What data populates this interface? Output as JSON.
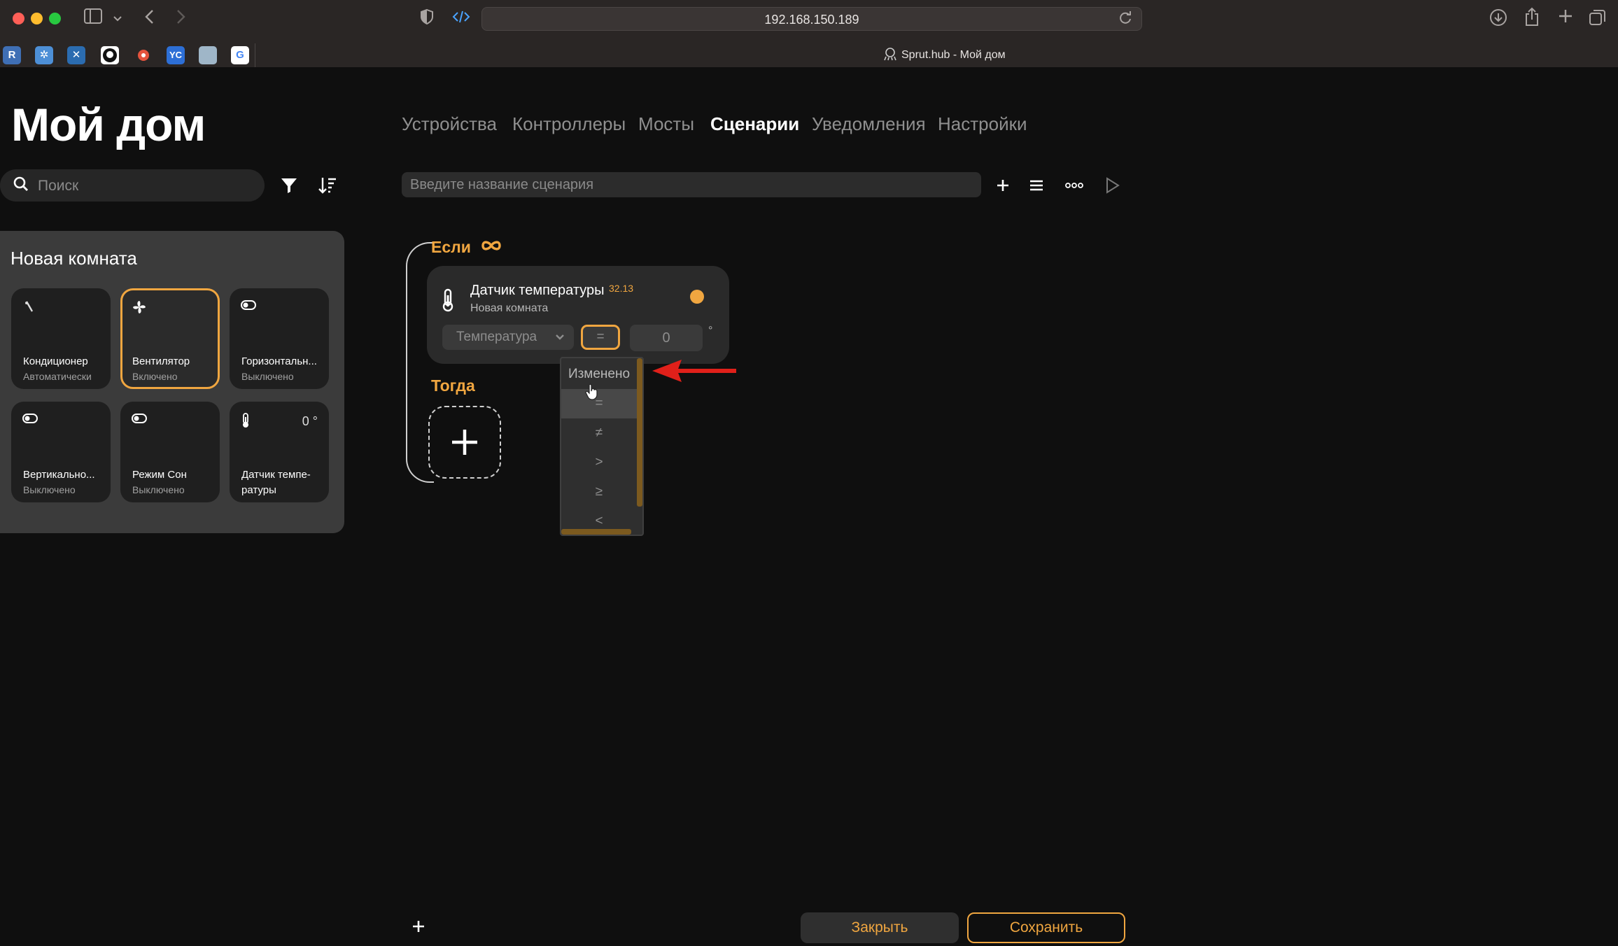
{
  "browser": {
    "url": "192.168.150.189",
    "tab_title": "Sprut.hub - Мой дом",
    "favicons": [
      "R",
      "✲",
      "✕",
      "",
      "",
      "YC",
      "",
      "G"
    ]
  },
  "app": {
    "page_title": "Мой дом",
    "search_placeholder": "Поиск",
    "room": {
      "title": "Новая комната",
      "tiles": [
        {
          "name": "Кондиционер",
          "status": "Автоматически",
          "icon": "ac-icon",
          "active": false
        },
        {
          "name": "Вентилятор",
          "status": "Включено",
          "icon": "fan-icon",
          "active": true
        },
        {
          "name": "Горизонтальн...",
          "status": "Выключено",
          "icon": "toggle-icon",
          "active": false
        },
        {
          "name": "Вертикально...",
          "status": "Выключено",
          "icon": "toggle-icon",
          "active": false
        },
        {
          "name": "Режим Сон",
          "status": "Выключено",
          "icon": "toggle-icon",
          "active": false
        },
        {
          "name": "Датчик темпе-ратуры",
          "status": "",
          "icon": "thermometer-icon",
          "value": "0 °",
          "active": false
        }
      ]
    },
    "nav_tabs": [
      {
        "label": "Устройства",
        "active": false
      },
      {
        "label": "Контроллеры",
        "active": false
      },
      {
        "label": "Мосты",
        "active": false
      },
      {
        "label": "Сценарии",
        "active": true
      },
      {
        "label": "Уведомления",
        "active": false
      },
      {
        "label": "Настройки",
        "active": false
      }
    ],
    "scenario": {
      "name_placeholder": "Введите название сценария",
      "if_label": "Если",
      "then_label": "Тогда",
      "condition": {
        "device_name": "Датчик температуры",
        "device_value": "32.13",
        "device_room": "Новая комната",
        "characteristic": "Температура",
        "operator": "=",
        "value": "0",
        "unit": "°"
      },
      "operator_options": [
        "Изменено",
        "=",
        "≠",
        ">",
        "≥",
        "<"
      ],
      "hovered_option": "="
    },
    "footer": {
      "close_label": "Закрыть",
      "save_label": "Сохранить"
    }
  },
  "colors": {
    "accent": "#f0a640",
    "background": "#0f0f0f",
    "annotation_arrow": "#e0201a"
  }
}
